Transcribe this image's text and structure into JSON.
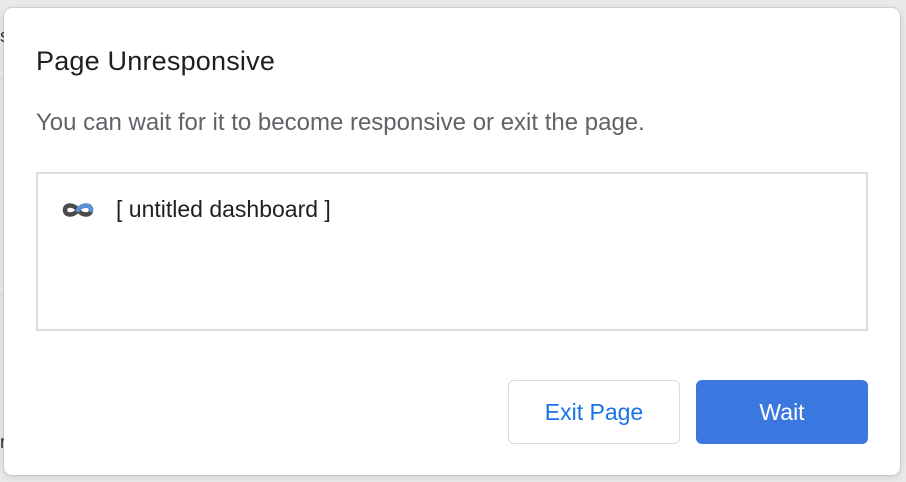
{
  "backdrop": {
    "glyphs": [
      "s",
      "n"
    ]
  },
  "dialog": {
    "title": "Page Unresponsive",
    "message": "You can wait for it to become responsive or exit the page.",
    "pages": [
      {
        "icon": "infinity-logo-icon",
        "title": "[ untitled dashboard ]"
      }
    ],
    "buttons": {
      "exit_label": "Exit Page",
      "wait_label": "Wait"
    }
  },
  "colors": {
    "primary": "#3a78e0",
    "link_blue": "#1a73e8",
    "text": "#1f1f1f",
    "secondary_text": "#5f6368",
    "border": "#dadce0"
  }
}
